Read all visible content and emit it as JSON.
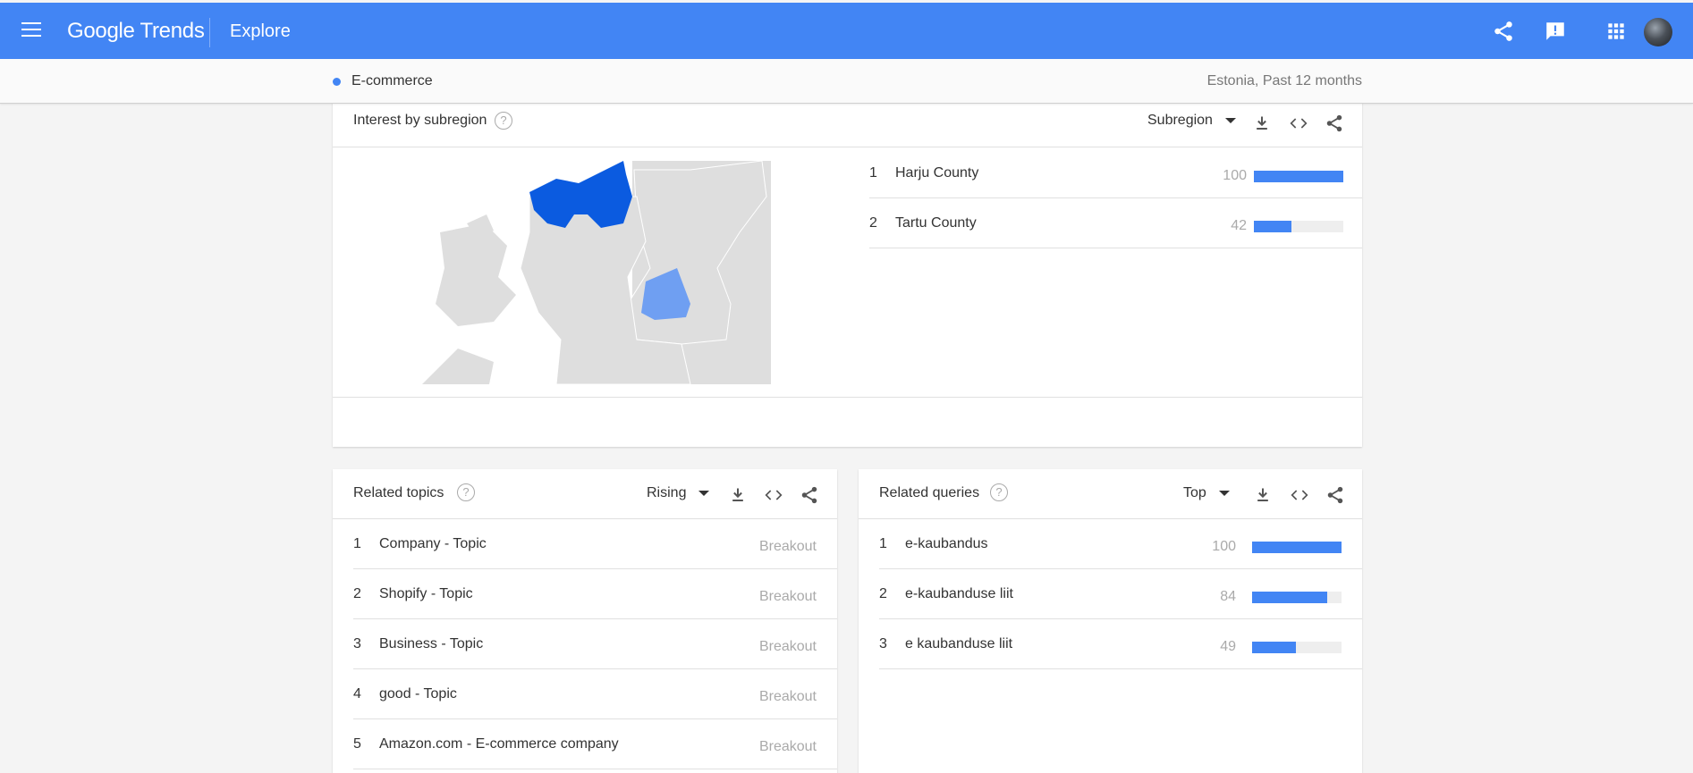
{
  "appbar": {
    "brand": "Google Trends",
    "section": "Explore",
    "icons": [
      "menu-icon",
      "share-icon",
      "feedback-icon",
      "apps-icon",
      "avatar"
    ]
  },
  "search": {
    "term": "E-commerce",
    "term_color": "#4285f4",
    "filters": "Estonia, Past 12 months"
  },
  "subregion": {
    "title": "Interest by subregion",
    "dropdown": "Subregion",
    "rows": [
      {
        "rank": "1",
        "name": "Harju County",
        "value": "100",
        "fill": 1.0
      },
      {
        "rank": "2",
        "name": "Tartu County",
        "value": "42",
        "fill": 0.42
      }
    ],
    "map": {
      "highlight_strong": "#0b5be0",
      "highlight_light": "#6f9ff2",
      "base": "#dedede"
    }
  },
  "topics": {
    "title": "Related topics",
    "dropdown": "Rising",
    "rows": [
      {
        "rank": "1",
        "name": "Company - Topic",
        "value": "Breakout"
      },
      {
        "rank": "2",
        "name": "Shopify - Topic",
        "value": "Breakout"
      },
      {
        "rank": "3",
        "name": "Business - Topic",
        "value": "Breakout"
      },
      {
        "rank": "4",
        "name": "good - Topic",
        "value": "Breakout"
      },
      {
        "rank": "5",
        "name": "Amazon.com - E-commerce company",
        "value": "Breakout"
      }
    ]
  },
  "queries": {
    "title": "Related queries",
    "dropdown": "Top",
    "rows": [
      {
        "rank": "1",
        "name": "e-kaubandus",
        "value": "100",
        "fill": 1.0
      },
      {
        "rank": "2",
        "name": "e-kaubanduse liit",
        "value": "84",
        "fill": 0.84
      },
      {
        "rank": "3",
        "name": "e kaubanduse liit",
        "value": "49",
        "fill": 0.49
      }
    ]
  },
  "colors": {
    "accent": "#4285f4",
    "bar_track": "#eeeeee"
  }
}
